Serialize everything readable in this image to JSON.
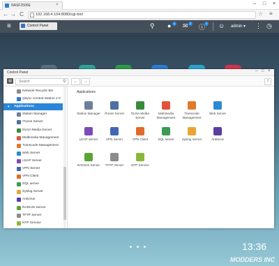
{
  "browser": {
    "tab_title": "NASF2500E",
    "url": "192.168.4.104:8080/cgi-bin/",
    "tab_close": "×",
    "back": "←",
    "forward": "→",
    "reload": "C",
    "star": "☆",
    "menu": "≡",
    "minimize": "–",
    "maximize": "□",
    "close": "×"
  },
  "desktop": {
    "topbar": {
      "menu": "≡",
      "control_panel_tab": "Control Panel",
      "search": "⚲",
      "tasks": "●",
      "tasks_badge": "1",
      "notifications": "✉",
      "notifications_badge": "2",
      "info": "ⓘ",
      "info_badge": "1",
      "user_label": "admin ▾",
      "more": "⋮",
      "dashboard": "◷"
    },
    "clock": {
      "time": "13:36",
      "date": ""
    },
    "watermark": "MODDERS INC"
  },
  "control_panel": {
    "title": "Control Panel",
    "search_placeholder": "Search",
    "back": "←",
    "forward": "→",
    "help": "?",
    "min": "–",
    "max": "□",
    "close": "×",
    "sidebar": [
      {
        "label": "Network Recycle Bin",
        "color": "#8a8a8a",
        "type": "item"
      },
      {
        "label": "Qsync Central Station 2.0",
        "color": "#2a7dd1",
        "type": "item"
      },
      {
        "label": "Applications",
        "color": "",
        "type": "section"
      },
      {
        "label": "Station Manager",
        "color": "#6e7f99",
        "type": "item"
      },
      {
        "label": "iTunes Server",
        "color": "#4d6fa3",
        "type": "item"
      },
      {
        "label": "DLNA Media Server",
        "color": "#3a8a3a",
        "type": "item"
      },
      {
        "label": "Multimedia Management",
        "color": "#e0533b",
        "type": "item"
      },
      {
        "label": "Transcode Management",
        "color": "#e07a2b",
        "type": "item"
      },
      {
        "label": "Web Server",
        "color": "#2c8ad3",
        "type": "item"
      },
      {
        "label": "LDAP Server",
        "color": "#7b4cb5",
        "type": "item"
      },
      {
        "label": "VPN Server",
        "color": "#4267b2",
        "type": "item"
      },
      {
        "label": "VPN Client",
        "color": "#e26a2c",
        "type": "item"
      },
      {
        "label": "SQL server",
        "color": "#3c9a56",
        "type": "item"
      },
      {
        "label": "Syslog Server",
        "color": "#e9a534",
        "type": "item"
      },
      {
        "label": "Antivirus",
        "color": "#5a3fa0",
        "type": "item"
      },
      {
        "label": "RADIUS Server",
        "color": "#5aa532",
        "type": "item"
      },
      {
        "label": "TFTP Server",
        "color": "#8c8c8c",
        "type": "item"
      },
      {
        "label": "NTP Service",
        "color": "#8cb83a",
        "type": "item"
      }
    ],
    "main": {
      "heading": "Applications",
      "apps": [
        {
          "name": "Station Manager",
          "color": "#6e7f99"
        },
        {
          "name": "iTunes Server",
          "color": "#4d6fa3"
        },
        {
          "name": "DLNA Media Server",
          "color": "#3a8a3a"
        },
        {
          "name": "Multimedia Management",
          "color": "#e0533b"
        },
        {
          "name": "Transcode Management",
          "color": "#e07a2b"
        },
        {
          "name": "Web Server",
          "color": "#2c8ad3"
        },
        {
          "name": "LDAP Server",
          "color": "#7b4cb5"
        },
        {
          "name": "VPN Server",
          "color": "#4267b2"
        },
        {
          "name": "VPN Client",
          "color": "#e26a2c"
        },
        {
          "name": "SQL server",
          "color": "#3c9a56"
        },
        {
          "name": "Syslog Server",
          "color": "#e9a534"
        },
        {
          "name": "Antivirus",
          "color": "#5a3fa0"
        },
        {
          "name": "RADIUS Server",
          "color": "#5aa532"
        },
        {
          "name": "TFTP Server",
          "color": "#8c8c8c"
        },
        {
          "name": "NTP Service",
          "color": "#8cb83a"
        }
      ]
    }
  }
}
